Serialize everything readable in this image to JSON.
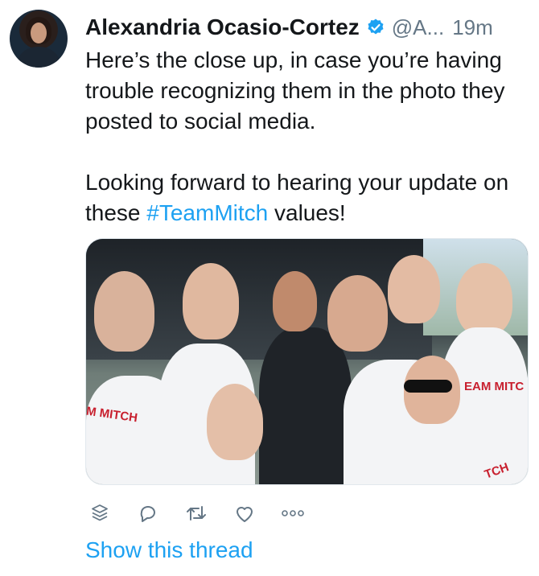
{
  "tweet": {
    "author_name": "Alexandria Ocasio-Cortez",
    "handle": "@A...",
    "time": "19m",
    "text_paragraphs": [
      {
        "before": "Here’s the close up, in case you’re having trouble recognizing them in the photo they posted to social media.",
        "hashtag": "",
        "after": ""
      },
      {
        "before": "Looking forward to hearing your update on these ",
        "hashtag": "#TeamMitch",
        "after": " values!"
      }
    ],
    "media_text": [
      "EAM MITC",
      "M MITCH",
      "TCH"
    ]
  },
  "actions": [
    {
      "name": "view-activity",
      "icon": "layers-icon"
    },
    {
      "name": "reply",
      "icon": "reply-icon"
    },
    {
      "name": "retweet",
      "icon": "retweet-icon"
    },
    {
      "name": "like",
      "icon": "heart-icon"
    },
    {
      "name": "more",
      "icon": "more-icon"
    }
  ],
  "show_thread_label": "Show this thread",
  "colors": {
    "accent": "#1da1f2",
    "secondary": "#657786",
    "text": "#14171a"
  }
}
